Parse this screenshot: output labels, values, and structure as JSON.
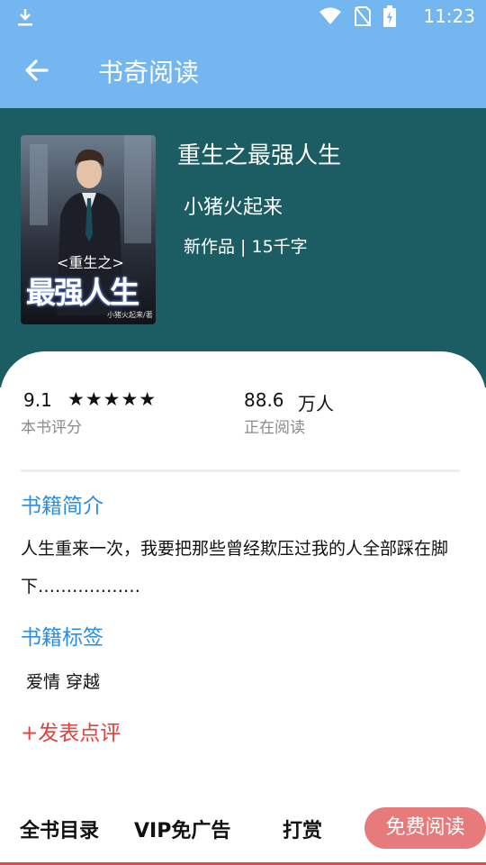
{
  "status_bar": {
    "time": "11:23"
  },
  "app_bar": {
    "title": "书奇阅读"
  },
  "book": {
    "title": "重生之最强人生",
    "author": "小猪火起来",
    "meta": "新作品 | 15千字",
    "cover_text_top": "<重生之>",
    "cover_text_main": "最强人生",
    "cover_text_small": "小猪火起来/著"
  },
  "stats": {
    "rating": "9.1",
    "stars": "★★★★★",
    "rating_label": "本书评分",
    "readers": "88.6",
    "readers_unit": "万人",
    "readers_label": "正在阅读"
  },
  "intro": {
    "heading": "书籍简介",
    "text": "人生重来一次，我要把那些曾经欺压过我的人全部踩在脚下………………"
  },
  "tags": {
    "heading": "书籍标签",
    "text": "爱情 穿越"
  },
  "review_label": "+发表点评",
  "bottom_bar": {
    "catalog": "全书目录",
    "vip": "VIP免广告",
    "reward": "打赏",
    "read": "免费阅读"
  },
  "colors": {
    "app_bar": "#74b6f0",
    "header": "#1b5d63",
    "accent_blue": "#2b8de0",
    "accent_red": "#e0413a",
    "read_button": "#e77b7b"
  }
}
